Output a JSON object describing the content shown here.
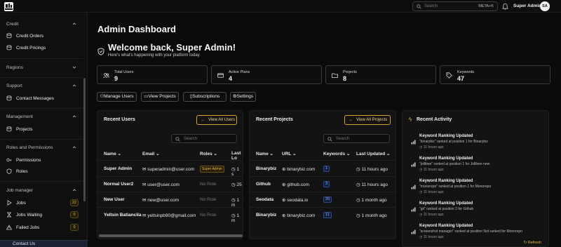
{
  "topbar": {
    "search_placeholder": "Search",
    "search_shortcut": "META+K",
    "user_name": "Super Admin",
    "user_initials": "SA"
  },
  "sidebar": {
    "credit": {
      "title": "Credit",
      "items": [
        "Credit Orders",
        "Credit Pricings"
      ]
    },
    "regions": {
      "title": "Regions"
    },
    "support": {
      "title": "Support",
      "items": [
        "Contact Messages"
      ]
    },
    "management": {
      "title": "Management",
      "items": [
        "Projects"
      ]
    },
    "roles": {
      "title": "Roles and Permissions",
      "items": [
        "Permissions",
        "Roles"
      ]
    },
    "jobs": {
      "title": "Job manager",
      "items": [
        {
          "label": "Jobs",
          "badge": "22"
        },
        {
          "label": "Jobs Waiting",
          "badge": "0"
        },
        {
          "label": "Failed Jobs",
          "badge": "0"
        }
      ]
    },
    "contact": "Contact Us"
  },
  "page": {
    "title": "Admin Dashboard",
    "welcome": "Welcome back, Super Admin!",
    "subtitle": "Here's what's happening with your platform today"
  },
  "stats": [
    {
      "label": "Total Users",
      "value": "9",
      "icon": "users-icon"
    },
    {
      "label": "Active Plans",
      "value": "4",
      "icon": "card-icon"
    },
    {
      "label": "Projects",
      "value": "8",
      "icon": "folder-icon"
    },
    {
      "label": "Keywords",
      "value": "47",
      "icon": "tag-icon"
    }
  ],
  "quick_actions": [
    "Manage Users",
    "View Projects",
    "Subscriptions",
    "Settings"
  ],
  "recent_users": {
    "title": "Recent Users",
    "button": "View All Users",
    "search_placeholder": "Search",
    "columns": [
      "Name",
      "Email",
      "Roles",
      "Last Lo"
    ],
    "rows": [
      {
        "name": "Super Admin",
        "email": "superadmin@user.com",
        "role": "Super Admin",
        "last": "1 s"
      },
      {
        "name": "Normal User2",
        "email": "user@user.com",
        "role": "No Role",
        "last": "25"
      },
      {
        "name": "New User",
        "email": "new@user.com",
        "role": "No Role",
        "last": "1 m"
      },
      {
        "name": "Yeltsin Batiancila",
        "email": "yeltsinpb90@gmail.com",
        "role": "No Role",
        "last": "1 m"
      }
    ]
  },
  "recent_projects": {
    "title": "Recent Projects",
    "button": "View All Projects",
    "search_placeholder": "Search",
    "columns": [
      "Name",
      "URL",
      "Keywords",
      "Last Updated"
    ],
    "rows": [
      {
        "name": "Binarybiz",
        "url": "binarybiz.com",
        "keywords": "1",
        "updated": "11 hours ago"
      },
      {
        "name": "Github",
        "url": "github.com",
        "keywords": "3",
        "updated": "11 hours ago"
      },
      {
        "name": "Seodata",
        "url": "seodata.io",
        "keywords": "20",
        "updated": "1 month ago"
      },
      {
        "name": "Binarybiz",
        "url": "binarybiz.com",
        "keywords": "11",
        "updated": "1 month ago"
      }
    ]
  },
  "recent_activity": {
    "title": "Recent Activity",
    "refresh": "Refresh",
    "items": [
      {
        "title": "Keyword Ranking Updated",
        "desc": "\"binarybiz\" ranked at position 1 for Binarybiz",
        "time": "11 hours ago"
      },
      {
        "title": "Keyword Ranking Updated",
        "desc": "\"jollibee\" ranked at position 1 for Jollibee new",
        "time": "11 hours ago"
      },
      {
        "title": "Keyword Ranking Updated",
        "desc": "\"monorepo\" ranked at position 1 for Monorepo",
        "time": "11 hours ago"
      },
      {
        "title": "Keyword Ranking Updated",
        "desc": "\"git\" ranked at position 2 for Github",
        "time": "11 hours ago"
      },
      {
        "title": "Keyword Ranking Updated",
        "desc": "\"screenshot manager\" ranked at position Not ranked for Monorepo",
        "time": "11 hours ago"
      }
    ]
  },
  "colors": {
    "accent": "#e9b949",
    "background": "#0b0b0b",
    "panel": "#131313"
  }
}
